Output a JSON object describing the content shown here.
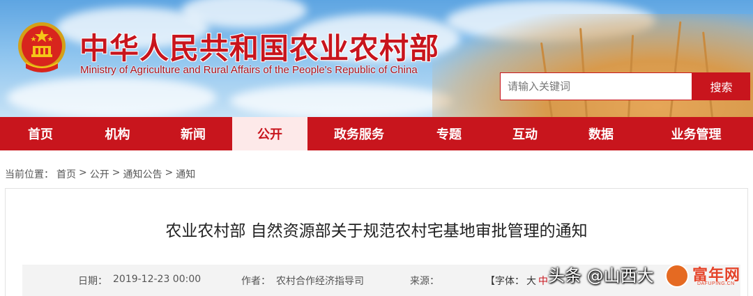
{
  "header": {
    "title": "中华人民共和国农业农村部",
    "subtitle": "Ministry of Agriculture and Rural Affairs of the People's Republic of China",
    "search_placeholder": "请输入关键词",
    "search_button": "搜索"
  },
  "nav": {
    "items": [
      {
        "label": "首页"
      },
      {
        "label": "机构"
      },
      {
        "label": "新闻"
      },
      {
        "label": "公开"
      },
      {
        "label": "政务服务"
      },
      {
        "label": "专题"
      },
      {
        "label": "互动"
      },
      {
        "label": "数据"
      },
      {
        "label": "业务管理"
      }
    ],
    "active_index": 3
  },
  "breadcrumb": {
    "prefix": "当前位置：",
    "items": [
      "首页",
      "公开",
      "通知公告",
      "通知"
    ],
    "separator": " > "
  },
  "article": {
    "title": "农业农村部 自然资源部关于规范农村宅基地审批管理的通知",
    "meta": {
      "date_label": "日期：",
      "date_value": "2019-12-23 00:00",
      "author_label": "作者：",
      "author_value": "农村合作经济指导司",
      "source_label": "来源：",
      "source_value": "",
      "font_label": "【字体：",
      "font_large": "大",
      "font_medium": "中"
    }
  },
  "watermark": {
    "text": "头条 @山西大",
    "brand": "富年网",
    "url": "DAFUPING.CN"
  },
  "colors": {
    "brand_red": "#c8151d",
    "active_nav_bg": "#fde9e9",
    "meta_bg": "#f3f3f3"
  }
}
